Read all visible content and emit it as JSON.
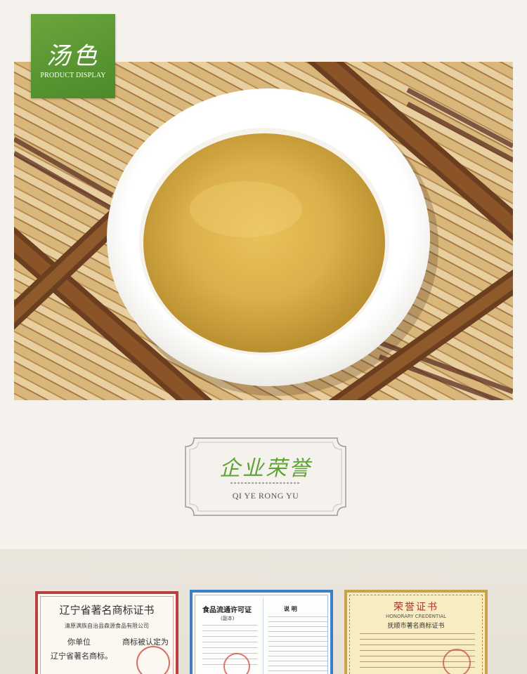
{
  "badge": {
    "title": "汤色",
    "subtitle": "PRODUCT DISPLAY"
  },
  "honor_section": {
    "title": "企业荣誉",
    "subtitle": "QI YE RONG YU"
  },
  "certificates": [
    {
      "title": "辽宁省著名商标证书",
      "company": "清原满族自治县森源食品有限公司",
      "line1": "你单位",
      "line1_end": "商标被认定为",
      "line2": "辽宁省著名商标。",
      "border_color": "#b8403e"
    },
    {
      "title": "食品流通许可证",
      "subtitle": "(副本)",
      "notes_title": "说 明",
      "border_color": "#3b7fc4"
    },
    {
      "title": "荣誉证书",
      "subtitle_en": "HONORARY CREDENTIAL",
      "subtitle_cn": "抚顺市著名商标证书",
      "border_color": "#c9a24a"
    }
  ]
}
